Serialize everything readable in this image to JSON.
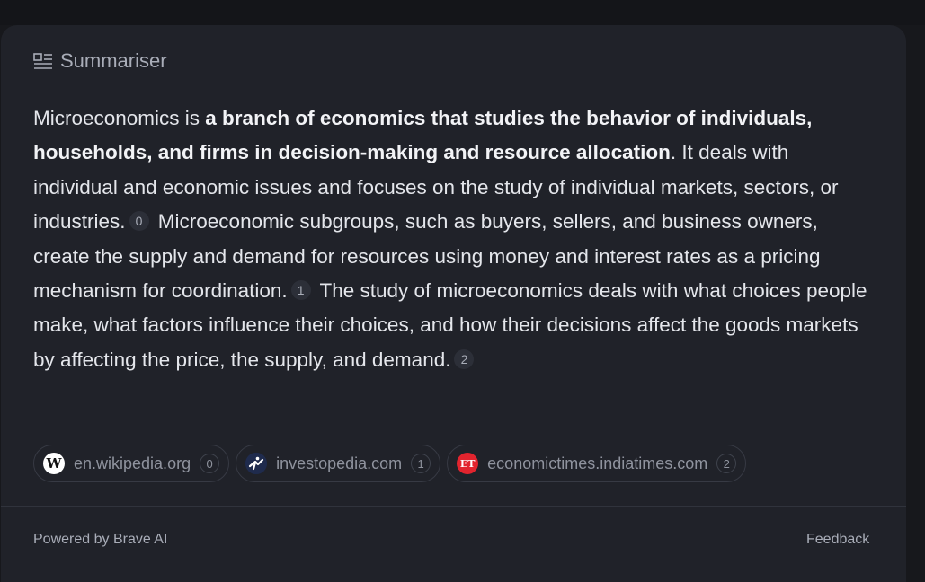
{
  "header": {
    "title": "Summariser",
    "icon": "summary-icon"
  },
  "summary": {
    "p1": "Microeconomics is ",
    "bold": "a branch of economics that studies the behavior of individuals, households, and firms in decision-making and resource allocation",
    "p2": ". It deals with individual and economic issues and focuses on the study of individual markets, sectors, or industries.",
    "cite0": "0",
    "p3": " Microeconomic subgroups, such as buyers, sellers, and business owners, create the supply and demand for resources using money and interest rates as a pricing mechanism for coordination.",
    "cite1": "1",
    "p4": " The study of microeconomics deals with what choices people make, what factors influence their choices, and how their decisions affect the goods markets by affecting the price, the supply, and demand.",
    "cite2": "2"
  },
  "sources": [
    {
      "domain": "en.wikipedia.org",
      "num": "0",
      "favicon": "W",
      "icon": "wikipedia-icon"
    },
    {
      "domain": "investopedia.com",
      "num": "1",
      "favicon": "",
      "icon": "investopedia-icon"
    },
    {
      "domain": "economictimes.indiatimes.com",
      "num": "2",
      "favicon": "ET",
      "icon": "economictimes-icon"
    }
  ],
  "footer": {
    "powered_by": "Powered by Brave AI",
    "feedback": "Feedback"
  },
  "colors": {
    "background": "#17181c",
    "card": "#202229",
    "text": "#e4e6eb",
    "muted": "#a9adb8"
  }
}
